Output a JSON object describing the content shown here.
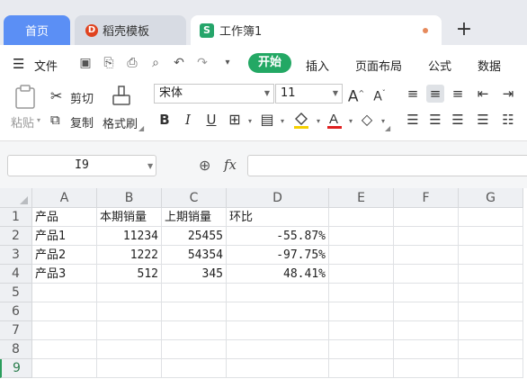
{
  "tabs": {
    "home": "首页",
    "docer": "稻壳模板",
    "workbook": "工作簿1",
    "plus": "+"
  },
  "menu": {
    "file": "文件",
    "start": "开始",
    "insert": "插入",
    "page_layout": "页面布局",
    "formula": "公式",
    "data": "数据"
  },
  "ribbon": {
    "paste": "粘贴",
    "cut": "剪切",
    "copy": "复制",
    "format_painter": "格式刷",
    "font_name": "宋体",
    "font_size": "11"
  },
  "formula_bar": {
    "cell_ref": "I9",
    "fx": "fx",
    "content": ""
  },
  "sheet": {
    "columns": [
      "A",
      "B",
      "C",
      "D",
      "E",
      "F",
      "G"
    ],
    "rows": [
      "1",
      "2",
      "3",
      "4",
      "5",
      "6",
      "7",
      "8",
      "9"
    ],
    "cells": [
      [
        "产品",
        "本期销量",
        "上期销量",
        "环比"
      ],
      [
        "产品1",
        "11234",
        "25455",
        "-55.87%"
      ],
      [
        "产品2",
        "1222",
        "54354",
        "-97.75%"
      ],
      [
        "产品3",
        "512",
        "345",
        "48.41%"
      ]
    ]
  }
}
